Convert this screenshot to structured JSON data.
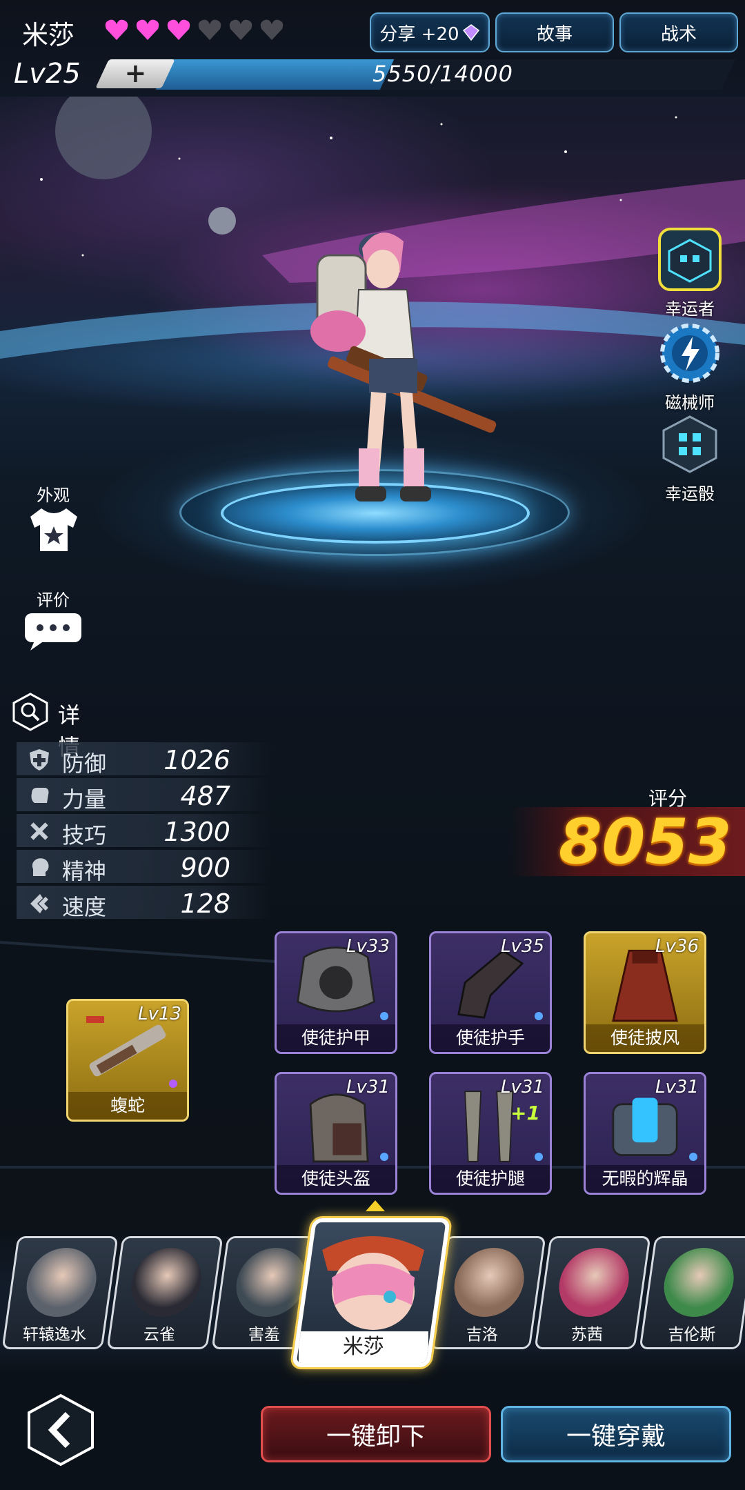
{
  "header": {
    "character_name": "米莎",
    "hearts_filled": 3,
    "hearts_total": 6,
    "share_label": "分享 +20",
    "story_label": "故事",
    "tactics_label": "战术",
    "level": "Lv25",
    "plus_label": "+",
    "xp_current": 5550,
    "xp_max": 14000,
    "xp_text": "5550/14000"
  },
  "skills": [
    {
      "label": "幸运者",
      "icon": "lucky-cube-icon"
    },
    {
      "label": "磁械师",
      "icon": "lightning-gear-icon"
    },
    {
      "label": "幸运骰",
      "icon": "lucky-dice-icon"
    }
  ],
  "side_buttons": {
    "appearance_label": "外观",
    "review_label": "评价"
  },
  "stats": {
    "detail_label": "详情",
    "rows": [
      {
        "name": "防御",
        "value": "1026",
        "icon": "shield-icon"
      },
      {
        "name": "力量",
        "value": "487",
        "icon": "fist-icon"
      },
      {
        "name": "技巧",
        "value": "1300",
        "icon": "tools-icon"
      },
      {
        "name": "精神",
        "value": "900",
        "icon": "mind-icon"
      },
      {
        "name": "速度",
        "value": "128",
        "icon": "speed-icon"
      }
    ]
  },
  "score": {
    "label": "评分",
    "value": "8053"
  },
  "weapon": {
    "level": "Lv13",
    "name": "蝮蛇"
  },
  "equipment": [
    {
      "level": "Lv33",
      "name": "使徒护甲",
      "rarity": "purple",
      "extra": ""
    },
    {
      "level": "Lv35",
      "name": "使徒护手",
      "rarity": "purple",
      "extra": ""
    },
    {
      "level": "Lv36",
      "name": "使徒披风",
      "rarity": "gold",
      "extra": ""
    },
    {
      "level": "Lv31",
      "name": "使徒头盔",
      "rarity": "purple",
      "extra": ""
    },
    {
      "level": "Lv31",
      "name": "使徒护腿",
      "rarity": "purple",
      "extra": "+1"
    },
    {
      "level": "Lv31",
      "name": "无暇的辉晶",
      "rarity": "purple",
      "extra": ""
    }
  ],
  "roster": {
    "left": [
      "轩辕逸水",
      "云雀",
      "害羞"
    ],
    "selected": "米莎",
    "right": [
      "吉洛",
      "苏茜",
      "吉伦斯"
    ]
  },
  "buttons": {
    "unequip_all": "一键卸下",
    "equip_all": "一键穿戴"
  },
  "colors": {
    "heart_filled": "#ff4fdc",
    "heart_empty": "#4a4a52",
    "score": "#ffcf2e",
    "accent_blue": "#5fa8d6",
    "accent_red": "#e24d4d"
  }
}
